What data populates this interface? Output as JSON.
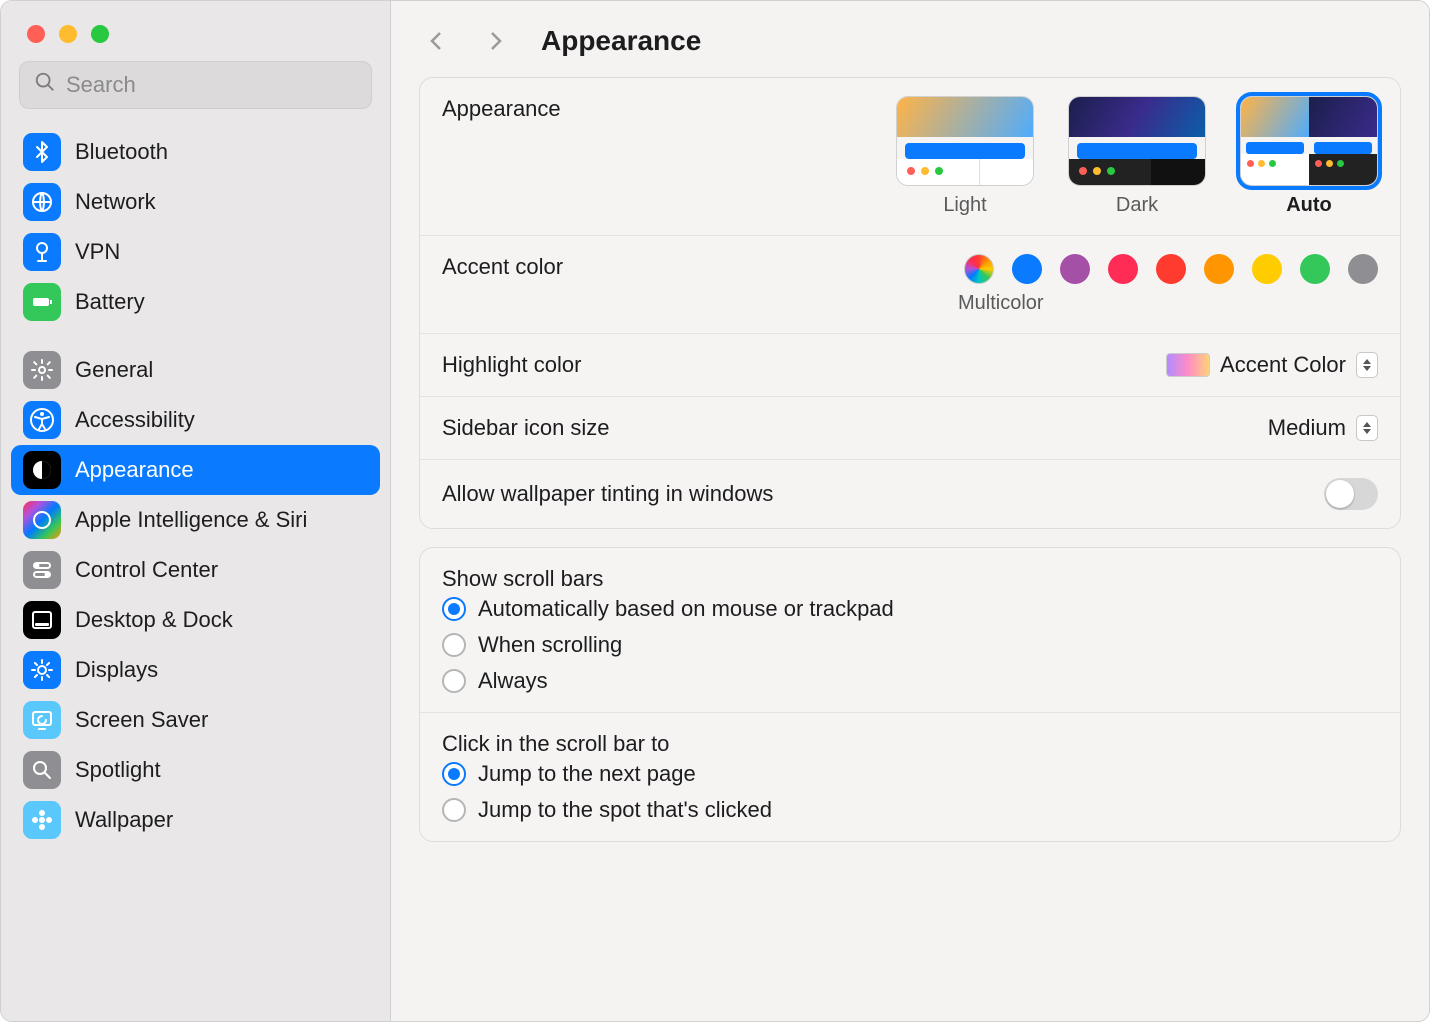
{
  "window": {
    "title": "Appearance"
  },
  "search": {
    "placeholder": "Search"
  },
  "sidebar": {
    "items": [
      {
        "label": "Bluetooth",
        "icon": "bluetooth",
        "bg": "#0a7aff"
      },
      {
        "label": "Network",
        "icon": "globe",
        "bg": "#0a7aff"
      },
      {
        "label": "VPN",
        "icon": "vpn",
        "bg": "#0a7aff"
      },
      {
        "label": "Battery",
        "icon": "battery",
        "bg": "#34c759"
      },
      {
        "spacer": true
      },
      {
        "label": "General",
        "icon": "gear",
        "bg": "#8e8e93"
      },
      {
        "label": "Accessibility",
        "icon": "accessibility",
        "bg": "#0a7aff"
      },
      {
        "label": "Appearance",
        "icon": "appearance",
        "bg": "#000000",
        "selected": true
      },
      {
        "label": "Apple Intelligence & Siri",
        "icon": "siri",
        "bg": "linear-gradient(135deg,#ff2d55,#af52de,#007aff,#34c759,#ff9500)"
      },
      {
        "label": "Control Center",
        "icon": "switches",
        "bg": "#8e8e93"
      },
      {
        "label": "Desktop & Dock",
        "icon": "dock",
        "bg": "#000000"
      },
      {
        "label": "Displays",
        "icon": "brightness",
        "bg": "#0a7aff"
      },
      {
        "label": "Screen Saver",
        "icon": "screensaver",
        "bg": "#5ac8fa"
      },
      {
        "label": "Spotlight",
        "icon": "search",
        "bg": "#8e8e93"
      },
      {
        "label": "Wallpaper",
        "icon": "flower",
        "bg": "#5ac8fa"
      }
    ]
  },
  "appearance": {
    "label": "Appearance",
    "options": [
      {
        "label": "Light",
        "selected": false
      },
      {
        "label": "Dark",
        "selected": false
      },
      {
        "label": "Auto",
        "selected": true
      }
    ]
  },
  "accent": {
    "label": "Accent color",
    "selected_label": "Multicolor",
    "colors": [
      "multicolor",
      "#0a7aff",
      "#a550a7",
      "#ff2d55",
      "#ff3b30",
      "#ff9500",
      "#ffcc00",
      "#34c759",
      "#8e8e93"
    ]
  },
  "highlight": {
    "label": "Highlight color",
    "value": "Accent Color"
  },
  "sidebar_icon_size": {
    "label": "Sidebar icon size",
    "value": "Medium"
  },
  "wallpaper_tint": {
    "label": "Allow wallpaper tinting in windows",
    "value": false
  },
  "scroll_bars": {
    "heading": "Show scroll bars",
    "options": [
      {
        "label": "Automatically based on mouse or trackpad",
        "checked": true
      },
      {
        "label": "When scrolling",
        "checked": false
      },
      {
        "label": "Always",
        "checked": false
      }
    ]
  },
  "scroll_click": {
    "heading": "Click in the scroll bar to",
    "options": [
      {
        "label": "Jump to the next page",
        "checked": true
      },
      {
        "label": "Jump to the spot that's clicked",
        "checked": false
      }
    ]
  }
}
